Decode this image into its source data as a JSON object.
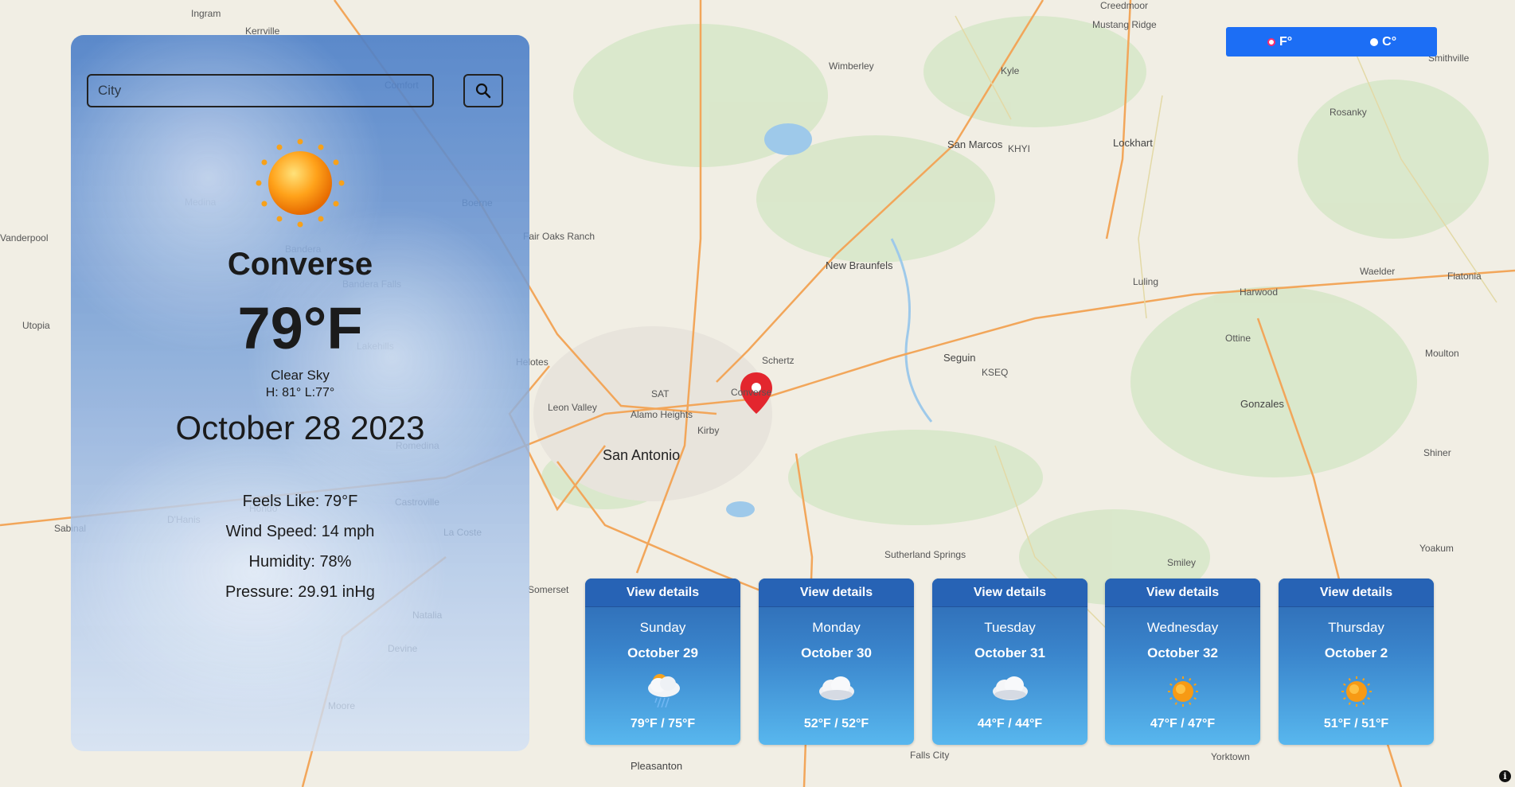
{
  "map": {
    "labels": [
      "Ingram",
      "Kerrville",
      "Comfort",
      "Medina",
      "Boerne",
      "Bandera",
      "Bandera Falls",
      "Lakehills",
      "Utopia",
      "Vanderpool",
      "Fair Oaks Ranch",
      "Helotes",
      "Leon Valley",
      "Alamo Heights",
      "San Antonio",
      "Kirby",
      "Schertz",
      "Converse",
      "New Braunfels",
      "Wimberley",
      "Kyle",
      "San Marcos",
      "Lockhart",
      "Mustang Ridge",
      "Creedmoor",
      "Seguin",
      "Luling",
      "Harwood",
      "Waelder",
      "Flatonia",
      "Ottine",
      "Moulton",
      "Gonzales",
      "Shiner",
      "Yoakum",
      "Smiley",
      "Sutherland Springs",
      "Somerset",
      "Natalia",
      "Devine",
      "Moore",
      "Pleasanton",
      "Falls City",
      "Yorktown",
      "Castroville",
      "La Coste",
      "Hondo",
      "D'Hanis",
      "Sabinal",
      "Rosanky",
      "Smithville",
      "Romedina",
      "SAT",
      "KSEQ",
      "KHYI"
    ]
  },
  "search": {
    "placeholder": "City"
  },
  "current": {
    "city": "Converse",
    "temp": "79°F",
    "condition": "Clear Sky",
    "hilo": "H: 81° L:77°",
    "date": "October 28 2023",
    "feels_like": "Feels Like: 79°F",
    "wind": "Wind Speed: 14 mph",
    "humidity": "Humidity: 78%",
    "pressure": "Pressure: 29.91 inHg",
    "icon": "sun-icon"
  },
  "units": {
    "fahrenheit": "F°",
    "celsius": "C°",
    "selected": "fahrenheit"
  },
  "forecast": [
    {
      "button": "View details",
      "day": "Sunday",
      "date": "October 29",
      "temps": "79°F / 75°F",
      "icon": "rain-cloud-icon"
    },
    {
      "button": "View details",
      "day": "Monday",
      "date": "October 30",
      "temps": "52°F / 52°F",
      "icon": "cloud-icon"
    },
    {
      "button": "View details",
      "day": "Tuesday",
      "date": "October 31",
      "temps": "44°F / 44°F",
      "icon": "cloud-icon"
    },
    {
      "button": "View details",
      "day": "Wednesday",
      "date": "October 32",
      "temps": "47°F / 47°F",
      "icon": "sun-icon"
    },
    {
      "button": "View details",
      "day": "Thursday",
      "date": "October 2",
      "temps": "51°F / 51°F",
      "icon": "sun-icon"
    }
  ],
  "colors": {
    "accent": "#1c6ef5",
    "pin": "#e3262e"
  }
}
